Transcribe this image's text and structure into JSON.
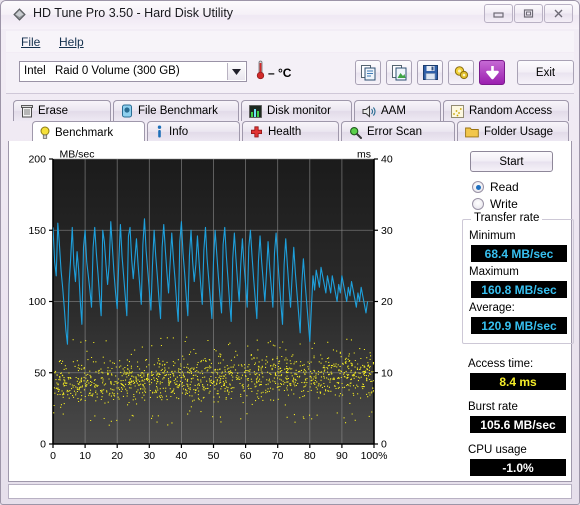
{
  "window": {
    "title": "HD Tune Pro 3.50 - Hard Disk Utility",
    "app_icon": "hdtune-diamond-icon",
    "buttons": {
      "minimize": "minimize-icon",
      "maximize": "maximize-icon",
      "close": "close-icon"
    }
  },
  "menu": {
    "items": [
      {
        "label": "File",
        "accel": "F"
      },
      {
        "label": "Help",
        "accel": "H"
      }
    ]
  },
  "toolbar": {
    "drive": {
      "vendor": "Intel",
      "name": "Raid 0 Volume (300 GB)"
    },
    "temperature": "– °C",
    "buttons": [
      {
        "name": "copy-button",
        "icon": "copy-icon"
      },
      {
        "name": "copy-image-button",
        "icon": "copy-image-icon"
      },
      {
        "name": "save-button",
        "icon": "floppy-save-icon"
      },
      {
        "name": "options-button",
        "icon": "gears-icon"
      },
      {
        "name": "download-button",
        "icon": "download-arrow-icon"
      }
    ],
    "exit_label": "Exit"
  },
  "tabs": {
    "row1": [
      {
        "label": "Erase",
        "icon": "trash-icon",
        "active": false
      },
      {
        "label": "File Benchmark",
        "icon": "lightbulb-blue-icon",
        "active": false
      },
      {
        "label": "Disk monitor",
        "icon": "bar-chart-icon",
        "active": false
      },
      {
        "label": "AAM",
        "icon": "speaker-icon",
        "active": false
      },
      {
        "label": "Random Access",
        "icon": "scatter-icon",
        "active": false
      }
    ],
    "row2": [
      {
        "label": "Benchmark",
        "icon": "lightbulb-yellow-icon",
        "active": true
      },
      {
        "label": "Info",
        "icon": "info-icon",
        "active": false
      },
      {
        "label": "Health",
        "icon": "red-cross-icon",
        "active": false
      },
      {
        "label": "Error Scan",
        "icon": "magnifier-icon",
        "active": false
      },
      {
        "label": "Folder Usage",
        "icon": "folder-icon",
        "active": false
      }
    ]
  },
  "panel": {
    "start_label": "Start",
    "mode": {
      "read_label": "Read",
      "write_label": "Write",
      "selected": "Read"
    },
    "transfer_group_title": "Transfer rate",
    "minimum_label": "Minimum",
    "minimum_value": "68.4 MB/sec",
    "maximum_label": "Maximum",
    "maximum_value": "160.8 MB/sec",
    "average_label": "Average:",
    "average_value": "120.9 MB/sec",
    "access_time_label": "Access time:",
    "access_time_value": "8.4 ms",
    "burst_rate_label": "Burst rate",
    "burst_rate_value": "105.6 MB/sec",
    "cpu_usage_label": "CPU usage",
    "cpu_usage_value": "-1.0%"
  },
  "colors": {
    "transfer_line": "#1ea0dc",
    "access_dots": "#f2ea22",
    "plot_bg": "#2b2b2b",
    "grid": "#8c8c8c",
    "lcd_cyan": "#37c0f0",
    "lcd_yellow": "#f5ed2a"
  },
  "chart_data": {
    "type": "line",
    "title": "",
    "ylabel": "MB/sec",
    "ylabel_right": "ms",
    "xlabel": "",
    "xlim": [
      0,
      100
    ],
    "ylim": [
      0,
      200
    ],
    "ylim_right": [
      0,
      40
    ],
    "grid": true,
    "xticks": [
      0,
      10,
      20,
      30,
      40,
      50,
      60,
      70,
      80,
      90,
      100
    ],
    "xticklabels": [
      "0",
      "10",
      "20",
      "30",
      "40",
      "50",
      "60",
      "70",
      "80",
      "90",
      "100%"
    ],
    "yticks_left": [
      0,
      50,
      100,
      150,
      200
    ],
    "yticklabels_left": [
      "0",
      "50",
      "100",
      "150",
      "200"
    ],
    "yticks_right": [
      0,
      10,
      20,
      30,
      40
    ],
    "yticklabels_right": [
      "0",
      "10",
      "20",
      "30",
      "40"
    ],
    "series": [
      {
        "name": "Transfer rate",
        "axis": "left",
        "units": "MB/sec",
        "color": "#1ea0dc",
        "x": [
          0.0,
          0.5,
          1.0,
          1.5,
          2.0,
          2.5,
          3.0,
          3.5,
          4.0,
          4.5,
          5.0,
          5.5,
          6.0,
          6.5,
          7.0,
          7.5,
          8.0,
          8.5,
          9.0,
          9.5,
          10.0,
          10.5,
          11.0,
          11.5,
          12.0,
          12.5,
          13.0,
          13.5,
          14.0,
          14.5,
          15.0,
          15.5,
          16.0,
          16.5,
          17.0,
          17.5,
          18.0,
          18.5,
          19.0,
          19.5,
          20.0,
          20.5,
          21.0,
          21.5,
          22.0,
          22.5,
          23.0,
          23.5,
          24.0,
          24.5,
          25.0,
          25.5,
          26.0,
          26.5,
          27.0,
          27.5,
          28.0,
          28.5,
          29.0,
          29.5,
          30.0,
          30.5,
          31.0,
          31.5,
          32.0,
          32.5,
          33.0,
          33.5,
          34.0,
          34.5,
          35.0,
          35.5,
          36.0,
          36.5,
          37.0,
          37.5,
          38.0,
          38.5,
          39.0,
          39.5,
          40.0,
          40.5,
          41.0,
          41.5,
          42.0,
          42.5,
          43.0,
          43.5,
          44.0,
          44.5,
          45.0,
          45.5,
          46.0,
          46.5,
          47.0,
          47.5,
          48.0,
          48.5,
          49.0,
          49.5,
          50.0,
          50.5,
          51.0,
          51.5,
          52.0,
          52.5,
          53.0,
          53.5,
          54.0,
          54.5,
          55.0,
          55.5,
          56.0,
          56.5,
          57.0,
          57.5,
          58.0,
          58.5,
          59.0,
          59.5,
          60.0,
          60.5,
          61.0,
          61.5,
          62.0,
          62.5,
          63.0,
          63.5,
          64.0,
          64.5,
          65.0,
          65.5,
          66.0,
          66.5,
          67.0,
          67.5,
          68.0,
          68.5,
          69.0,
          69.5,
          70.0,
          70.5,
          71.0,
          71.5,
          72.0,
          72.5,
          73.0,
          73.5,
          74.0,
          74.5,
          75.0,
          75.5,
          76.0,
          76.5,
          77.0,
          77.5,
          78.0,
          78.5,
          79.0,
          79.5,
          80.0,
          80.5,
          81.0,
          81.5,
          82.0,
          82.5,
          83.0,
          83.5,
          84.0,
          84.5,
          85.0,
          85.5,
          86.0,
          86.5,
          87.0,
          87.5,
          88.0,
          88.5,
          89.0,
          89.5,
          90.0,
          90.5,
          91.0,
          91.5,
          92.0,
          92.5,
          93.0,
          93.5,
          94.0,
          94.5,
          95.0,
          95.5,
          96.0,
          96.5,
          97.0,
          97.5,
          98.0,
          98.5,
          99.0,
          99.5,
          100.0
        ],
        "y": [
          152,
          128,
          118,
          155,
          140,
          122,
          110,
          96,
          80,
          70,
          112,
          130,
          152,
          126,
          114,
          135,
          122,
          100,
          84,
          138,
          150,
          128,
          118,
          108,
          96,
          138,
          152,
          134,
          120,
          104,
          90,
          150,
          142,
          126,
          112,
          126,
          156,
          138,
          120,
          106,
          95,
          128,
          154,
          132,
          118,
          104,
          90,
          146,
          152,
          130,
          116,
          130,
          144,
          126,
          112,
          98,
          140,
          158,
          136,
          122,
          108,
          94,
          126,
          150,
          132,
          118,
          102,
          88,
          138,
          154,
          136,
          120,
          106,
          128,
          148,
          130,
          116,
          100,
          86,
          142,
          156,
          134,
          120,
          104,
          90,
          132,
          150,
          128,
          114,
          126,
          146,
          128,
          112,
          98,
          136,
          152,
          130,
          116,
          102,
          88,
          128,
          150,
          134,
          118,
          104,
          92,
          140,
          152,
          132,
          116,
          100,
          86,
          130,
          148,
          130,
          114,
          100,
          126,
          144,
          126,
          112,
          96,
          138,
          150,
          132,
          116,
          102,
          88,
          128,
          146,
          128,
          114,
          100,
          120,
          142,
          124,
          110,
          96,
          134,
          148,
          130,
          114,
          98,
          84,
          126,
          144,
          126,
          110,
          96,
          118,
          138,
          120,
          106,
          92,
          78,
          112,
          130,
          114,
          100,
          86,
          72,
          96,
          118,
          108,
          122,
          116,
          110,
          124,
          118,
          112,
          106,
          118,
          112,
          106,
          118,
          112,
          106,
          100,
          112,
          106,
          118,
          112,
          106,
          100,
          110,
          104,
          114,
          108,
          102,
          96,
          106,
          100,
          110,
          104,
          98,
          92,
          100
        ]
      },
      {
        "name": "Access time",
        "axis": "right",
        "units": "ms",
        "color": "#f2ea22",
        "type": "scatter",
        "mean_ms": 8.4,
        "spread_ms": [
          4.0,
          13.0
        ],
        "point_count": 1400
      }
    ]
  }
}
